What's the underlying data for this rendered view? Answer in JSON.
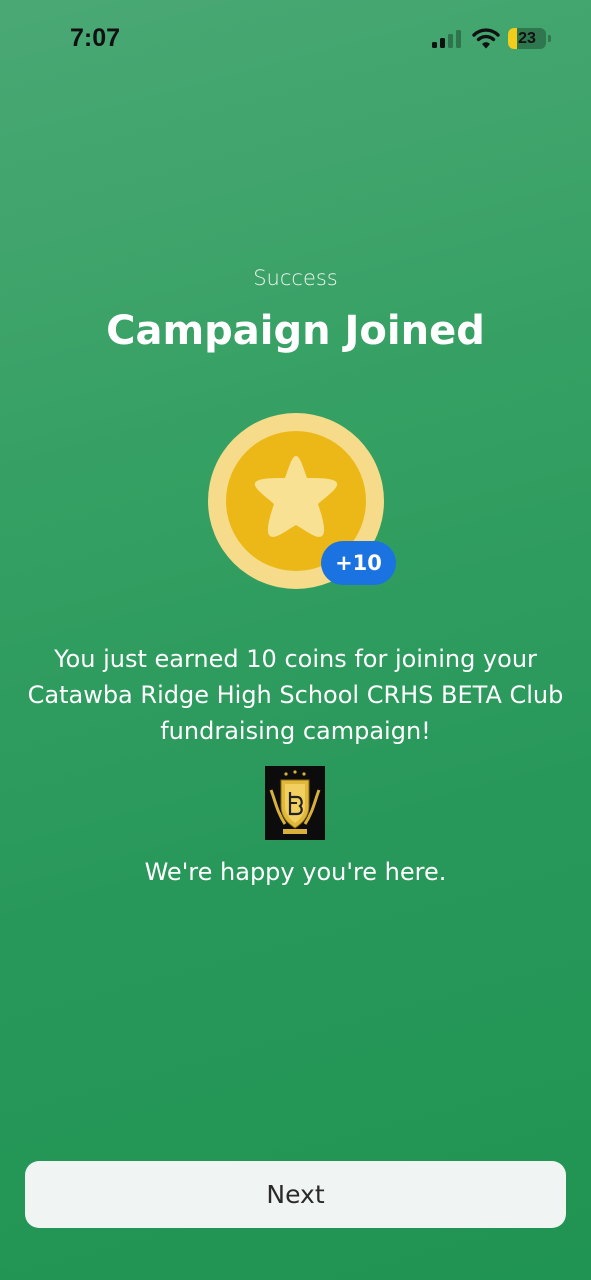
{
  "status_bar": {
    "time": "7:07",
    "battery_level": "23",
    "battery_fraction": 0.23,
    "icons": [
      "signal-icon",
      "wifi-icon",
      "battery-icon"
    ]
  },
  "header": {
    "subtitle": "Success",
    "title": "Campaign Joined"
  },
  "reward": {
    "icon": "star-coin-icon",
    "badge": "+10"
  },
  "message": {
    "text": "You just earned 10 coins for joining your Catawba Ridge High School CRHS BETA Club fundraising campaign!",
    "logo": "beta-club-logo",
    "closing": "We're happy you're here."
  },
  "footer": {
    "next_label": "Next"
  },
  "colors": {
    "background_top": "#4aa874",
    "background_bottom": "#209452",
    "coin_outer": "#f6dc8a",
    "coin_inner": "#ecb818",
    "badge": "#1a73e0",
    "button": "#f0f4f2"
  }
}
